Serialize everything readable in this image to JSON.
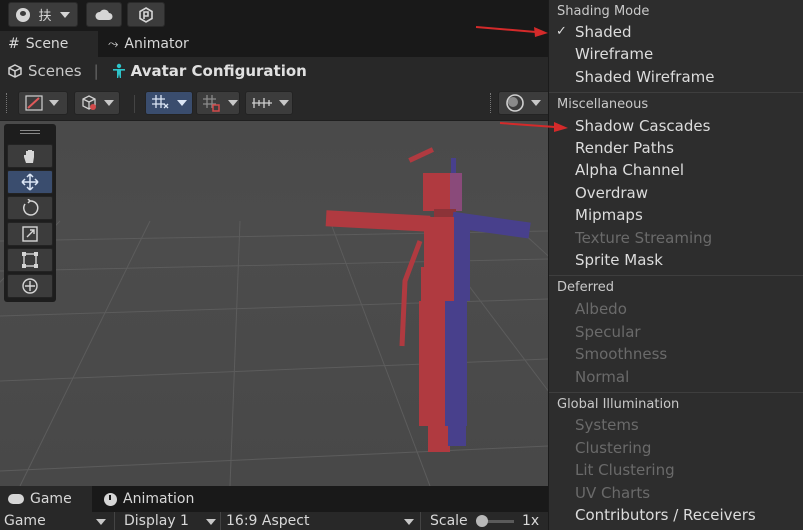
{
  "top_toolbar": {
    "account_label": "扶",
    "icons": [
      "account-icon",
      "cloud-icon",
      "collab-icon"
    ]
  },
  "tabs": [
    {
      "label": "Scene",
      "icon": "grid-icon",
      "active": true
    },
    {
      "label": "Animator",
      "icon": "animator-icon",
      "active": false
    }
  ],
  "breadcrumb": {
    "scenes_label": "Scenes",
    "current_label": "Avatar Configuration"
  },
  "bottom_tabs": [
    {
      "label": "Game",
      "icon": "gamepad-icon",
      "active": true
    },
    {
      "label": "Animation",
      "icon": "animation-icon",
      "active": false
    }
  ],
  "game_bar": {
    "mode": "Game",
    "display": "Display 1",
    "aspect": "16:9 Aspect",
    "scale_label": "Scale",
    "scale_value": "1x"
  },
  "shading_menu": {
    "sections": [
      {
        "header": "Shading Mode",
        "items": [
          {
            "label": "Shaded",
            "checked": true,
            "disabled": false
          },
          {
            "label": "Wireframe",
            "checked": false,
            "disabled": false
          },
          {
            "label": "Shaded Wireframe",
            "checked": false,
            "disabled": false
          }
        ]
      },
      {
        "header": "Miscellaneous",
        "items": [
          {
            "label": "Shadow Cascades",
            "disabled": false
          },
          {
            "label": "Render Paths",
            "disabled": false
          },
          {
            "label": "Alpha Channel",
            "disabled": false
          },
          {
            "label": "Overdraw",
            "disabled": false
          },
          {
            "label": "Mipmaps",
            "disabled": false
          },
          {
            "label": "Texture Streaming",
            "disabled": true
          },
          {
            "label": "Sprite Mask",
            "disabled": false
          }
        ]
      },
      {
        "header": "Deferred",
        "items": [
          {
            "label": "Albedo",
            "disabled": true
          },
          {
            "label": "Specular",
            "disabled": true
          },
          {
            "label": "Smoothness",
            "disabled": true
          },
          {
            "label": "Normal",
            "disabled": true
          }
        ]
      },
      {
        "header": "Global Illumination",
        "items": [
          {
            "label": "Systems",
            "disabled": true
          },
          {
            "label": "Clustering",
            "disabled": true
          },
          {
            "label": "Lit Clustering",
            "disabled": true
          },
          {
            "label": "UV Charts",
            "disabled": true
          },
          {
            "label": "Contributors / Receivers",
            "disabled": false
          }
        ]
      }
    ],
    "checkmark": "✓"
  },
  "colors": {
    "arrow_annotation": "#d42a2a",
    "avatar_red": "#b03a40",
    "avatar_blue": "#48408c",
    "accent_move": "#3a4d6e"
  }
}
